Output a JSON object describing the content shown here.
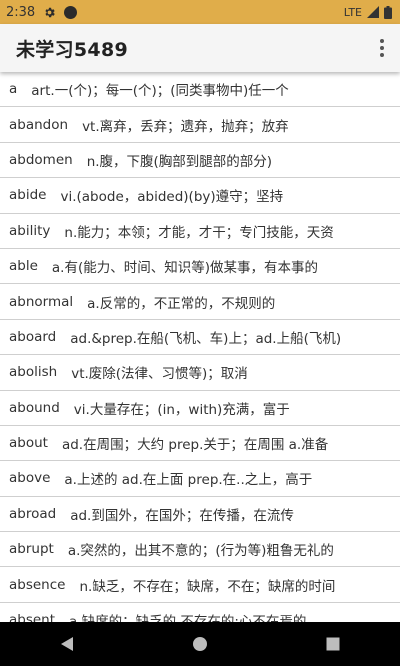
{
  "status_bar": {
    "time": "2:38",
    "network": "LTE",
    "icons": [
      "gear-icon",
      "dot-icon",
      "lte-signal-icon",
      "battery-icon"
    ]
  },
  "app_bar": {
    "title": "未学习5489",
    "menu_icon": "more-vert-icon"
  },
  "words": [
    {
      "word": "a",
      "definition": "art.一(个)；每一(个)；(同类事物中)任一个"
    },
    {
      "word": "abandon",
      "definition": "vt.离弃，丢弃；遗弃，抛弃；放弃"
    },
    {
      "word": "abdomen",
      "definition": "n.腹，下腹(胸部到腿部的部分)"
    },
    {
      "word": "abide",
      "definition": "vi.(abode，abided)(by)遵守；坚持"
    },
    {
      "word": "ability",
      "definition": "n.能力；本领；才能，才干；专门技能，天资"
    },
    {
      "word": "able",
      "definition": "a.有(能力、时间、知识等)做某事，有本事的"
    },
    {
      "word": "abnormal",
      "definition": "a.反常的，不正常的，不规则的"
    },
    {
      "word": "aboard",
      "definition": "ad.&prep.在船(飞机、车)上；ad.上船(飞机)"
    },
    {
      "word": "abolish",
      "definition": "vt.废除(法律、习惯等)；取消"
    },
    {
      "word": "abound",
      "definition": "vi.大量存在；(in，with)充满，富于"
    },
    {
      "word": "about",
      "definition": "ad.在周围；大约 prep.关于；在周围 a.准备"
    },
    {
      "word": "above",
      "definition": "a.上述的 ad.在上面  prep.在..之上，高于"
    },
    {
      "word": "abroad",
      "definition": "ad.到国外，在国外；在传播，在流传"
    },
    {
      "word": "abrupt",
      "definition": "a.突然的，出其不意的；(行为等)粗鲁无礼的"
    },
    {
      "word": "absence",
      "definition": "n.缺乏，不存在；缺席，不在；缺席的时间"
    },
    {
      "word": "absent",
      "definition": "a.缺席的；缺乏的,不存在的;心不在焉的"
    }
  ],
  "nav": {
    "back": "back-icon",
    "home": "home-icon",
    "recents": "recents-icon"
  }
}
